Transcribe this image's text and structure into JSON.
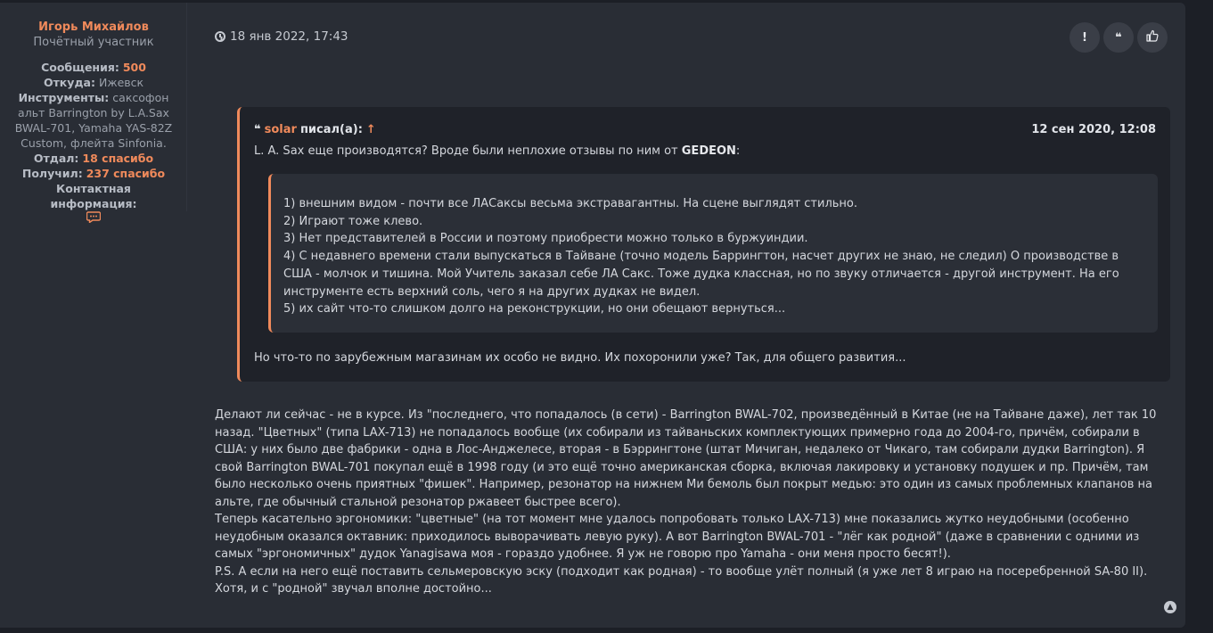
{
  "profile": {
    "username": "Игорь Михайлов",
    "rank": "Почётный участник",
    "messages_label": "Сообщения:",
    "messages_value": "500",
    "from_label": "Откуда:",
    "from_value": "Ижевск",
    "instruments_label": "Инструменты:",
    "instruments_value": "саксофон альт Barrington by L.A.Sax BWAL-701, Yamaha YAS-82Z Custom, флейта Sinfonia.",
    "gave_label": "Отдал:",
    "gave_value": "18 спасибо",
    "got_label": "Получил:",
    "got_value": "237 спасибо",
    "contact_label": "Контактная информация:",
    "contact_icon": "chat-bubble-icon"
  },
  "post": {
    "date": "18 янв 2022, 17:43",
    "actions": [
      {
        "name": "report",
        "glyph": "!"
      },
      {
        "name": "quote",
        "glyph": "❝"
      },
      {
        "name": "like",
        "glyph": "👍"
      }
    ]
  },
  "quote": {
    "icon": "❝",
    "author": "solar",
    "wrote": "писал(а):",
    "arrow": "↑",
    "date": "12 сен 2020, 12:08",
    "line1_prefix": "L. A. Sax еще производятся? Вроде были неплохие отзывы по ним от ",
    "line1_bold": "GEDEON",
    "line1_suffix": ":",
    "inner_lines": [
      "1) внешним видом - почти все ЛАСаксы весьма экстравагантны. На сцене выглядят стильно.",
      "2) Играют тоже клево.",
      "3) Нет представителей в России и поэтому приобрести можно только в буржуиндии.",
      "4) С недавнего времени стали выпускаться в Тайване (точно модель Баррингтон, насчет других не знаю, не следил) О производстве в США - молчок и тишина. Мой Учитель заказал себе ЛА Сакс. Тоже дудка классная, но по звуку отличается - другой инструмент. На его инструменте есть верхний соль, чего я на других дудках не видел.",
      "5) их сайт что-то слишком долго на реконструкции, но они обещают вернуться..."
    ],
    "tail": "Но что-то по зарубежным магазинам их особо не видно. Их похоронили уже? Так, для общего развития..."
  },
  "body": {
    "paragraphs": [
      "Делают ли сейчас - не в курсе. Из \"последнего, что попадалось (в сети) - Barrington BWAL-702, произведённый в Китае (не на Тайване даже), лет так 10 назад. \"Цветных\" (типа LAX-713) не попадалось вообще (их собирали из тайваньских комплектующих примерно года до 2004-го, причём, собирали в США: у них было две фабрики - одна в Лос-Анджелесе, вторая - в Бэррингтоне (штат Мичиган, недалеко от Чикаго, там собирали дудки Barrington). Я свой Barrington BWAL-701 покупал ещё в 1998 году (и это ещё точно американская сборка, включая лакировку и установку подушек и пр. Причём, там было несколько очень приятных \"фишек\". Например, резонатор на нижнем Ми бемоль был покрыт медью: это один из самых проблемных клапанов на альте, где обычный стальной резонатор ржавеет быстрее всего).",
      "Теперь касательно эргономики: \"цветные\" (на тот момент мне удалось попробовать только LAX-713) мне показались жутко неудобными (особенно неудобным оказался октавник: приходилось выворачивать левую руку). А вот Barrington BWAL-701 - \"лёг как родной\" (даже в сравнении с одними из самых \"эргономичных\" дудок Yanagisawa моя - гораздо удобнее. Я уж не говорю про Yamaha - они меня просто бесят!).",
      "P.S. А если на него ещё поставить сельмеровскую эску (подходит как родная) - то вообще улёт полный (я уже лет 8 играю на посеребренной SA-80 II). Хотя, и с \"родной\" звучал вполне достойно..."
    ]
  },
  "colors": {
    "accent": "#f08a5b",
    "background": "#292d35",
    "quote_bg": "#1f2229",
    "inner_quote_bg": "#2b2f37"
  }
}
